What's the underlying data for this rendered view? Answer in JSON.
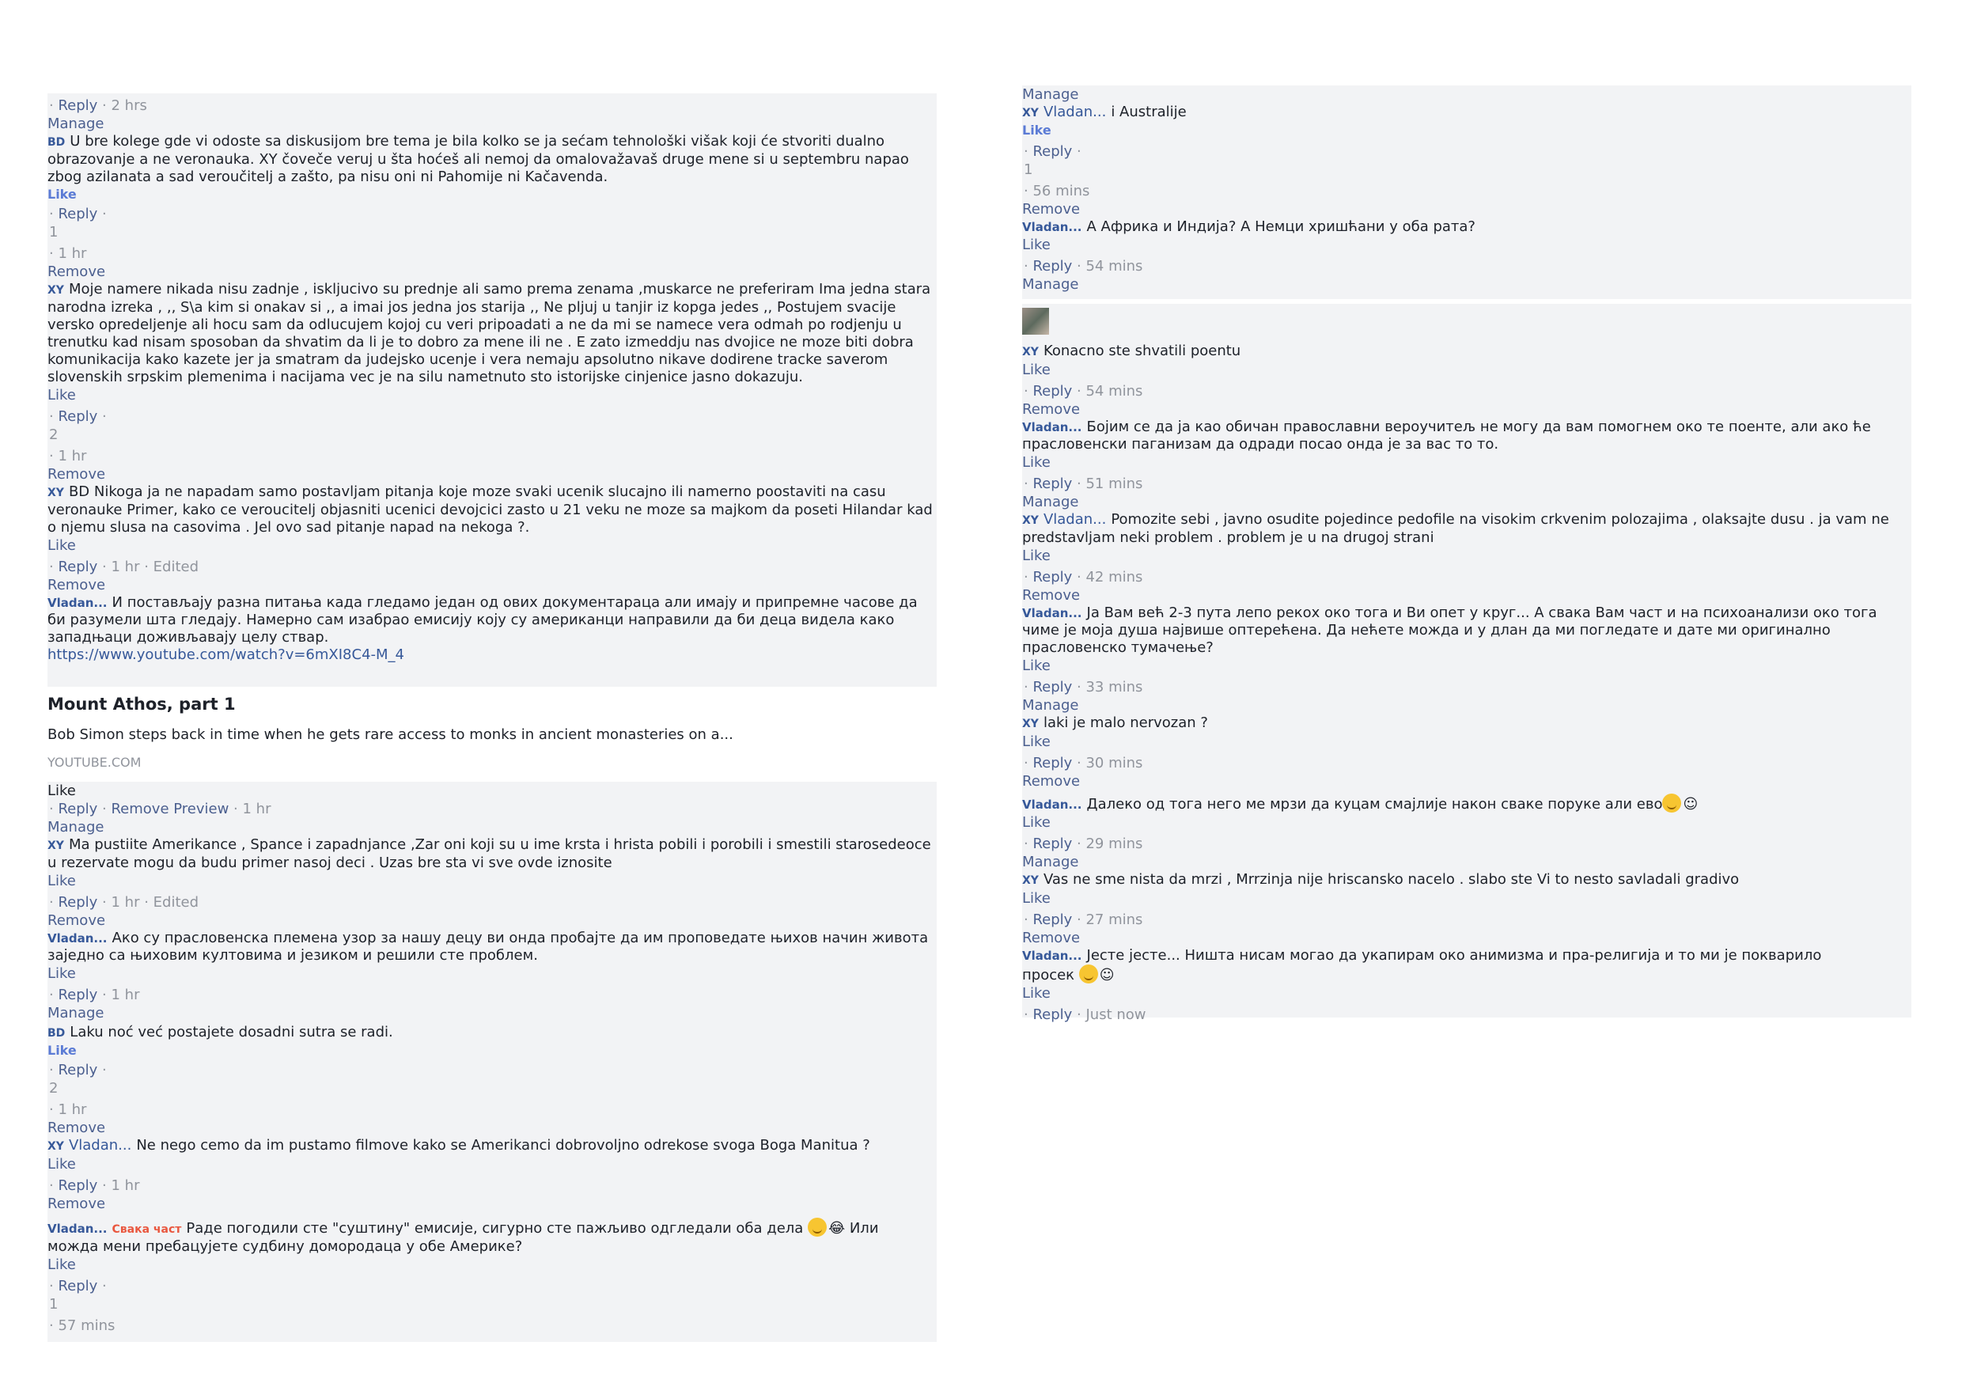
{
  "common": {
    "reply": "Reply",
    "manage": "Manage",
    "remove": "Remove",
    "like": "Like",
    "edited": "Edited",
    "remove_preview": "Remove Preview",
    "url": "https://www.youtube.com/watch?v=6mXI8C4-M_4"
  },
  "left": {
    "t_2hrs": "2 hrs",
    "c1": {
      "initials": "BD",
      "text": "U bre kolege gde vi odoste sa diskusijom bre tema je bila kolko se ja sećam tehnološki višak koji će stvoriti dualno obrazovanje a ne veronauka. XY čoveče veruj u šta hoćeš ali nemoj da omalovažavaš druge mene si u septembru napao zbog azilanata a sad veroučitelj a zašto, pa nisu oni ni Pahomije ni Kačavenda."
    },
    "count1": "1",
    "t_1hr": "1 hr",
    "c2": {
      "initials": "XY",
      "text": "Moje namere nikada nisu zadnje , iskljucivo su prednje ali samo prema zenama ,muskarce ne preferiram Ima jedna stara narodna izreka , ,, S\\a kim si onakav si ,, a imai jos jedna jos starija ,, Ne pljuj u tanjir iz kopga jedes ,, Postujem svacije versko opredeljenje ali hocu sam da odlucujem kojoj cu veri pripoadati a ne da mi se namece vera odmah po rodjenju u trenutku kad nisam sposoban da shvatim da li je to dobro za mene ili ne . E zato izmeddju nas dvojice ne moze biti dobra komunikacija kako kazete jer ja smatram da judejsko ucenje i vera nemaju apsolutno nikave dodirene tracke saverom slovenskih srpskim plemenima i nacijama vec je na silu nametnuto sto istorijske cinjenice jasno dokazuju."
    },
    "count2": "2",
    "c3": {
      "initials": "XY",
      "text": "BD Nikoga ja ne napadam samo postavljam pitanja koje moze svaki ucenik slucajno ili namerno poostaviti na casu veronauke Primer, kako ce veroucitelj objasniti ucenici devojcici zasto u 21 veku ne moze sa majkom da poseti Hilandar kad o njemu slusa na casovima . Jel ovo sad pitanje napad na nekoga ?."
    },
    "c4": {
      "author": "Vladan...",
      "text": "И постављају разна питања када гледамо један од ових документараца али имају и припремне часове да би разумели шта гледају. Намерно сам изабрао емисију коју су американци направили да би деца видела како западњаци доживљавају целу ствар."
    },
    "preview": {
      "title": "Mount Athos, part 1",
      "desc": "Bob Simon steps back in time when he gets rare access to monks in ancient monasteries on a...",
      "source": "YOUTUBE.COM"
    },
    "c5": {
      "initials": "XY",
      "text": "Ma pustiite Amerikance , Spance i zapadnjance ,Zar oni koji su u ime krsta i hrista pobili i porobili i smestili starosedeoce u rezervate mogu da budu primer nasoj deci . Uzas bre sta vi sve ovde iznosite"
    },
    "c6": {
      "author": "Vladan...",
      "text": "Ако су прасловенска племена узор за нашу децу ви онда пробајте да им проповедате њихов начин живота заједно са њиховим култовима и језиком и решили сте проблем."
    },
    "c7": {
      "initials": "BD",
      "text": "Laku noć već postajete dosadni sutra se radi."
    },
    "c8": {
      "initials": "XY",
      "mention": "Vladan...",
      "text": "Ne nego cemo da im pustamo filmove kako se Amerikanci dobrovoljno odrekose svoga Boga Manitua ?"
    },
    "c9": {
      "author": "Vladan...",
      "tag": "Свака част",
      "text_a": "Раде погодили сте \"суштину\" емисије, сигурно сте пажљиво одгледали оба дела",
      "faces": "😂",
      "text_b": "Или можда мени пребацујете судбину домородаца у обе Америке?"
    },
    "count9": "1",
    "t_57": "57 mins"
  },
  "right": {
    "c1": {
      "initials": "XY",
      "mention": "Vladan...",
      "text": "i Australije"
    },
    "count1": "1",
    "t_56": "56 mins",
    "c2": {
      "author": "Vladan...",
      "text": "А Африка и Индија? А Немци хришћани у оба рата?"
    },
    "t_54": "54 mins",
    "c3": {
      "initials": "XY",
      "text": "Konacno ste shvatili poentu"
    },
    "c4": {
      "author": "Vladan...",
      "text": "Бојим се да ја као обичан православни вероучитељ не могу да вам помогнем око те поенте, али ако ће прасловенски паганизам да одради посао онда је за вас то то."
    },
    "t_51": "51 mins",
    "c5": {
      "initials": "XY",
      "mention": "Vladan...",
      "text": "Pomozite sebi , javno osudite pojedince pedofile na visokim crkvenim polozajima , olaksajte dusu . ja vam ne predstavljam neki problem . problem je u na drugoj strani"
    },
    "t_42": "42 mins",
    "c6": {
      "author": "Vladan...",
      "text": "Ја Вам већ 2-3 пута лепо рекох око тога и Ви опет у круг... А свака Вам част и на психоанализи око тога чиме је моја душа највише оптерећена. Да нећете можда и у длан да ми погледате и дате ми оригинално прасловенско тумачење?"
    },
    "t_33": "33 mins",
    "c7": {
      "initials": "XY",
      "text": "laki je malo nervozan ?"
    },
    "t_30": "30 mins",
    "c8": {
      "author": "Vladan...",
      "text": "Далеко од тога него ме мрзи да куцам смајлије након сваке поруке али ево",
      "face": "☺"
    },
    "t_29": "29 mins",
    "c9": {
      "initials": "XY",
      "text": "Vas ne sme nista da mrzi , Mrrzinja nije hriscansko nacelo . slabo ste Vi to nesto savladali gradivo"
    },
    "t_27": "27 mins",
    "c10": {
      "author": "Vladan...",
      "text_a": "Јесте јесте... Ништа нисам могао да укапирам око анимизма и пра-религија и то ми је покварило",
      "text_b": "просек",
      "face": "☺"
    },
    "t_now": "Just now"
  }
}
